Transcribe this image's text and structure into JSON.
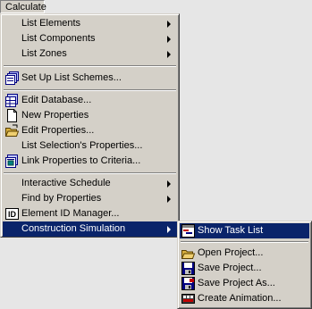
{
  "menubar": {
    "title": "Calculate"
  },
  "main_menu": {
    "list_elements": "List Elements",
    "list_components": "List Components",
    "list_zones": "List Zones",
    "set_up_list_schemes": "Set Up List Schemes...",
    "edit_database": "Edit Database...",
    "new_properties": "New Properties",
    "edit_properties": "Edit Properties...",
    "list_selections_properties": "List Selection's Properties...",
    "link_properties_to_criteria": "Link Properties to Criteria...",
    "interactive_schedule": "Interactive Schedule",
    "find_by_properties": "Find by Properties",
    "element_id_manager": "Element ID Manager...",
    "construction_simulation": "Construction Simulation"
  },
  "submenu": {
    "show_task_list": "Show Task List",
    "open_project": "Open Project...",
    "save_project": "Save Project...",
    "save_project_as": "Save Project As...",
    "create_animation": "Create Animation..."
  },
  "colors": {
    "menu_face": "#d4d0c8",
    "selection": "#0a246a",
    "background": "#e6e6e6"
  },
  "icons": [
    "list-schemes-icon",
    "database-icon",
    "new-properties-icon",
    "edit-properties-icon",
    "link-properties-icon",
    "id-manager-icon",
    "task-list-icon",
    "open-project-icon",
    "save-project-icon",
    "save-project-as-icon",
    "create-animation-icon"
  ]
}
